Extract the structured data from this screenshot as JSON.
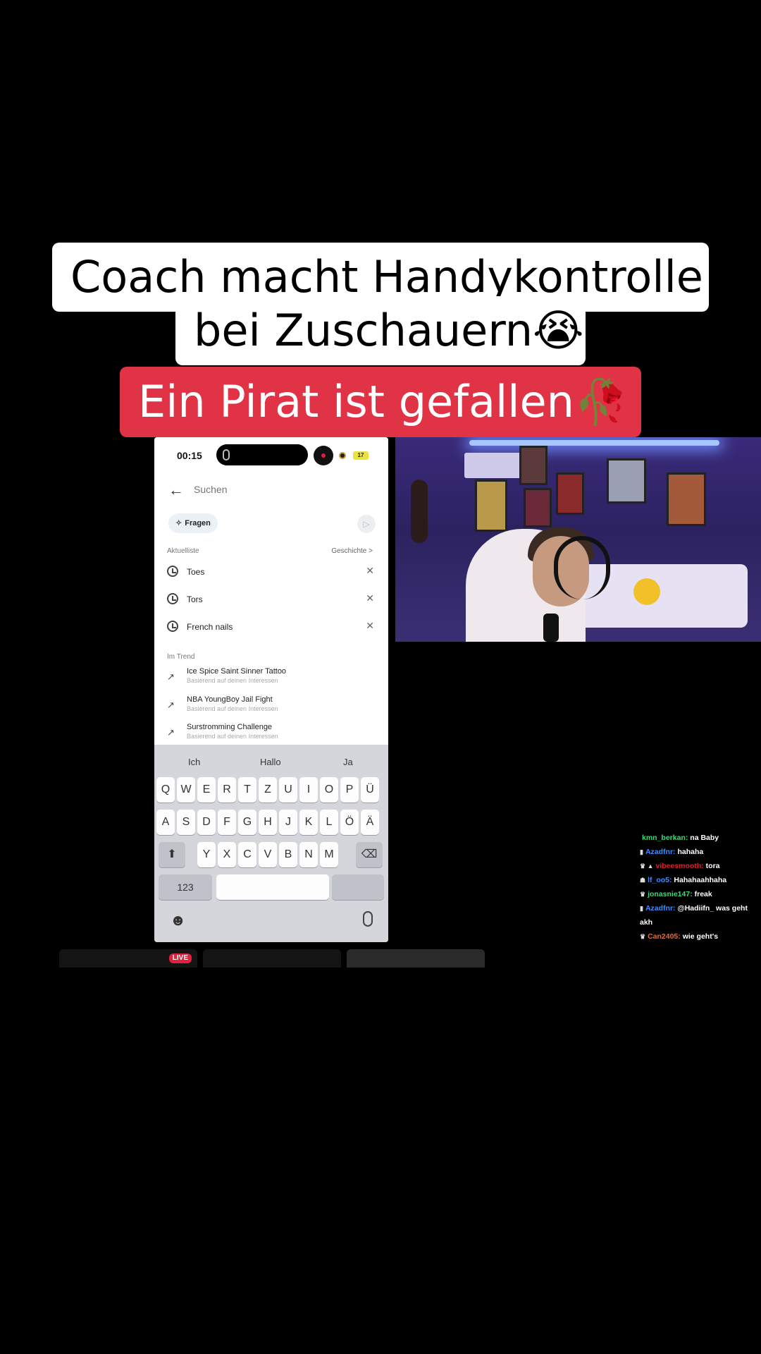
{
  "caption": {
    "line1": "Coach macht Handykontrolle",
    "line2": "bei Zuschauern😭",
    "line3": "Ein Pirat ist gefallen🥀"
  },
  "phone": {
    "status": {
      "time": "00:15",
      "battery": "17"
    },
    "search": {
      "back": "←",
      "placeholder": "Suchen"
    },
    "ask_chip": "Fragen",
    "recent_header": "Aktuelliste",
    "history_link": "Geschichte >",
    "recent": [
      {
        "label": "Toes"
      },
      {
        "label": "Tors"
      },
      {
        "label": "French nails"
      }
    ],
    "trend_header": "Im Trend",
    "trending": [
      {
        "title": "Ice Spice Saint Sinner Tattoo",
        "sub": "Basierend auf deinen Interessen"
      },
      {
        "title": "NBA YoungBoy Jail Fight",
        "sub": "Basierend auf deinen Interessen"
      },
      {
        "title": "Surstromming Challenge",
        "sub": "Basierend auf deinen Interessen"
      }
    ],
    "keyboard": {
      "suggestions": [
        "Ich",
        "Hallo",
        "Ja"
      ],
      "row1": [
        "Q",
        "W",
        "E",
        "R",
        "T",
        "Z",
        "U",
        "I",
        "O",
        "P",
        "Ü"
      ],
      "row2": [
        "A",
        "S",
        "D",
        "F",
        "G",
        "H",
        "J",
        "K",
        "L",
        "Ö",
        "Ä"
      ],
      "row3": [
        "Y",
        "X",
        "C",
        "V",
        "B",
        "N",
        "M"
      ],
      "numbers_key": "123",
      "shift_icon": "⬆",
      "delete_icon": "⌫",
      "emoji_icon": "☻"
    }
  },
  "chat": [
    {
      "user": "kmn_berkan:",
      "color": "#3fd67a",
      "text": "na Baby",
      "badge": ""
    },
    {
      "user": "Azadfnr:",
      "color": "#3f8cff",
      "text": "hahaha",
      "badge": "▮"
    },
    {
      "user": "vibeesmooth:",
      "color": "#d8232a",
      "text": "tora",
      "badge": "♛ ▲"
    },
    {
      "user": "lf_oo5:",
      "color": "#3f8cff",
      "text": "Hahahaahhaha",
      "badge": "☗"
    },
    {
      "user": "jonasnie147:",
      "color": "#3fd67a",
      "text": "freak",
      "badge": "♛"
    },
    {
      "user": "Azadfnr:",
      "color": "#3f8cff",
      "text": "@Hadiifn_ was geht akh",
      "badge": "▮"
    },
    {
      "user": "Can2405:",
      "color": "#e06a3a",
      "text": "wie geht's",
      "badge": "♛"
    }
  ],
  "live_badge": "LIVE"
}
